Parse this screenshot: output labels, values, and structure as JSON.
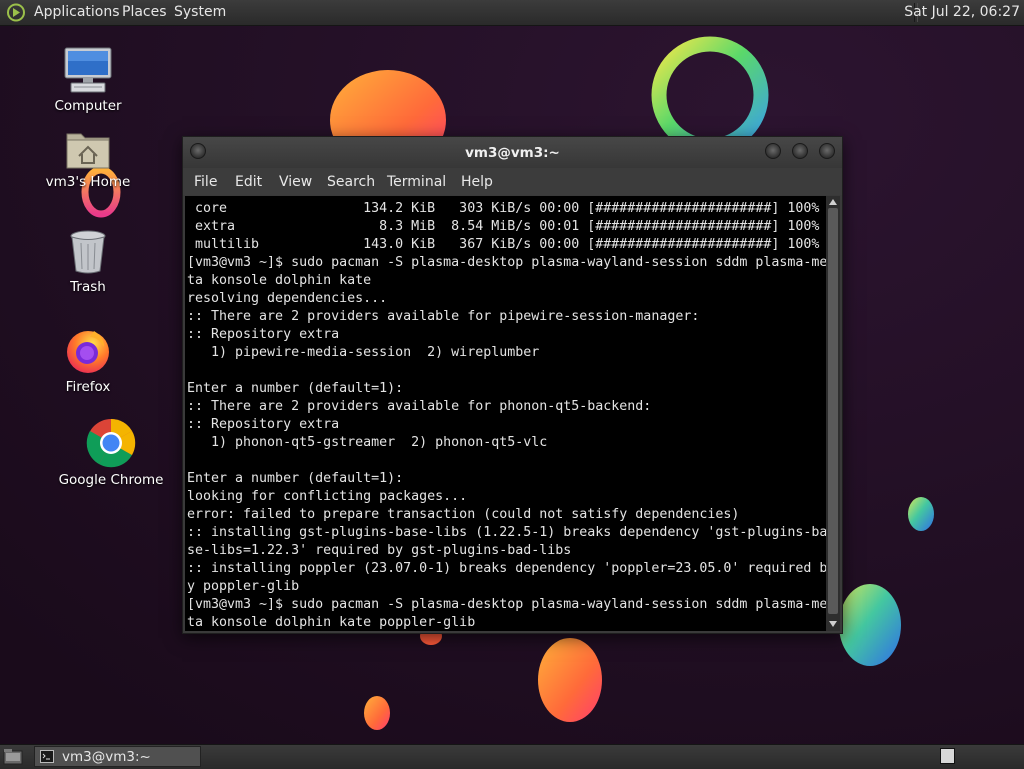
{
  "top_panel": {
    "menus": [
      "Applications",
      "Places",
      "System"
    ],
    "clock": "Sat Jul 22, 06:27",
    "logo_icon": "distro-logo-icon"
  },
  "desktop": {
    "icons": [
      {
        "label": "Computer",
        "icon": "computer-icon"
      },
      {
        "label": "vm3's Home",
        "icon": "home-folder-icon"
      },
      {
        "label": "Trash",
        "icon": "trash-icon"
      },
      {
        "label": "Firefox",
        "icon": "firefox-icon"
      },
      {
        "label": "Google Chrome",
        "icon": "chrome-icon"
      }
    ]
  },
  "terminal": {
    "title": "vm3@vm3:~",
    "menu": [
      "File",
      "Edit",
      "View",
      "Search",
      "Terminal",
      "Help"
    ],
    "lines": [
      " core                 134.2 KiB   303 KiB/s 00:00 [######################] 100%",
      " extra                  8.3 MiB  8.54 MiB/s 00:01 [######################] 100%",
      " multilib             143.0 KiB   367 KiB/s 00:00 [######################] 100%",
      "[vm3@vm3 ~]$ sudo pacman -S plasma-desktop plasma-wayland-session sddm plasma-me",
      "ta konsole dolphin kate",
      "resolving dependencies...",
      ":: There are 2 providers available for pipewire-session-manager:",
      ":: Repository extra",
      "   1) pipewire-media-session  2) wireplumber",
      "",
      "Enter a number (default=1):",
      ":: There are 2 providers available for phonon-qt5-backend:",
      ":: Repository extra",
      "   1) phonon-qt5-gstreamer  2) phonon-qt5-vlc",
      "",
      "Enter a number (default=1):",
      "looking for conflicting packages...",
      "error: failed to prepare transaction (could not satisfy dependencies)",
      ":: installing gst-plugins-base-libs (1.22.5-1) breaks dependency 'gst-plugins-ba",
      "se-libs=1.22.3' required by gst-plugins-bad-libs",
      ":: installing poppler (23.07.0-1) breaks dependency 'poppler=23.05.0' required b",
      "y poppler-glib",
      "[vm3@vm3 ~]$ sudo pacman -S plasma-desktop plasma-wayland-session sddm plasma-me",
      "ta konsole dolphin kate poppler-glib"
    ]
  },
  "bottom_panel": {
    "task_label": "vm3@vm3:~"
  }
}
